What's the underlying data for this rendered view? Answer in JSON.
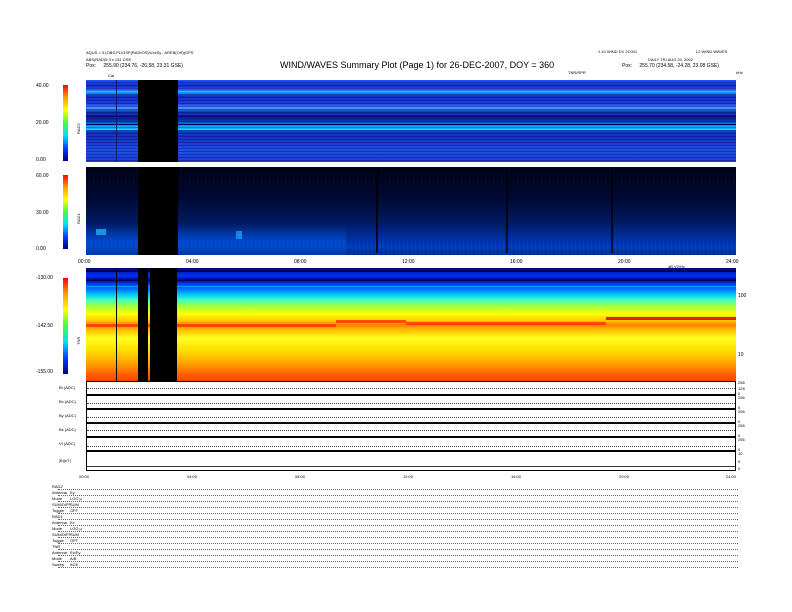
{
  "header": {
    "title": "WIND/WAVES Summary Plot (Page 1) for 26-DEC-2007, DOY = 360",
    "left_line1": "AQUS = 3 (OBS:PLIOSP(RADIOS)/UxxSy : AREB(OS))GPS",
    "left_line2": "ABS(RAD)5:3 x 131 GSE",
    "left_pos_label": "Pos:",
    "left_pos_value": "255.90 (234.76, -26.58, 23.31 GSE)",
    "right_line1": "1.10 WIND DV 2C001",
    "right_line2": "L2 WIND WAVES",
    "right_line3": "DAILY TRI AUG 20, 2002",
    "right_pos_label": "Pos:",
    "right_pos_value": "255.70 (234.58, -24.28, 23.08 GSE)",
    "cal_marker": "Cal",
    "top_right_label": "TNR/RPR",
    "top_right_unit": "kHz"
  },
  "panels": {
    "rad2": {
      "label": "RAD2",
      "ticks": [
        "40.00",
        "20.00",
        "0.00"
      ]
    },
    "rad1": {
      "label": "RAD1",
      "ticks": [
        "60.00",
        "30.00",
        "0.00"
      ]
    },
    "tnr": {
      "label": "TNR",
      "ticks": [
        "-130.00",
        "-142.50",
        "-155.00"
      ],
      "right_ticks": [
        "100",
        "10"
      ],
      "unit_label": "dB V2/Hz"
    }
  },
  "chart_data": [
    {
      "type": "heatmap",
      "title": "RAD2",
      "ylim": [
        0,
        40
      ],
      "x": [
        "00:00",
        "04:00",
        "08:00",
        "12:00",
        "16:00",
        "20:00",
        "24:00"
      ],
      "data_gaps_hours": [
        [
          2.05,
          2.8
        ],
        [
          2.8,
          3.35
        ]
      ]
    },
    {
      "type": "heatmap",
      "title": "RAD1",
      "ylim": [
        0,
        60
      ],
      "x": [
        "00:00",
        "04:00",
        "08:00",
        "12:00",
        "16:00",
        "20:00",
        "24:00"
      ],
      "data_gaps_hours": [
        [
          2.05,
          3.35
        ]
      ]
    },
    {
      "type": "heatmap",
      "title": "TNR",
      "ylim": [
        -155,
        -130
      ],
      "x": [
        "00:00",
        "04:00",
        "08:00",
        "12:00",
        "16:00",
        "20:00",
        "24:00"
      ],
      "data_gaps_hours": [
        [
          2.05,
          2.55
        ],
        [
          2.65,
          2.95
        ],
        [
          2.95,
          3.35
        ]
      ]
    }
  ],
  "time_axis_rad1": [
    "00:00",
    "04:00",
    "08:00",
    "12:00",
    "16:00",
    "20:00",
    "24:00"
  ],
  "time_axis_tnr": [
    "00:00",
    "04:00",
    "08:00",
    "12:00",
    "16:00",
    "20:00",
    "24:00"
  ],
  "time_axis_bottom": [
    "00:00",
    "04:00",
    "08:00",
    "12:00",
    "16:00",
    "20:00",
    "24:00"
  ],
  "line_panels": [
    {
      "label": "Bt (ADC)",
      "right_ticks": [
        "256",
        "128",
        "0"
      ]
    },
    {
      "label": "Bx (ADC)",
      "right_ticks": [
        "256",
        "0"
      ]
    },
    {
      "label": "By (ADC)",
      "right_ticks": [
        "256",
        "0"
      ]
    },
    {
      "label": "Bz (ADC)",
      "right_ticks": [
        "256",
        "0"
      ]
    },
    {
      "label": "Vt (ADC)",
      "right_ticks": [
        "256",
        "0"
      ]
    },
    {
      "label": "|B|(nT)",
      "right_ticks": [
        "10",
        "5",
        "0"
      ]
    }
  ],
  "info_block": [
    {
      "label": "RAD2",
      "value": ""
    },
    {
      "label": "Antenna",
      "value": "Ey"
    },
    {
      "label": "Mode",
      "value": "LOG µ"
    },
    {
      "label": "SUM/DIFF",
      "value": "SUM"
    },
    {
      "label": "Toggle",
      "value": "OFF"
    },
    {
      "label": "RAD1",
      "value": ""
    },
    {
      "label": "Antenna",
      "value": "Ex"
    },
    {
      "label": "Mode",
      "value": "LOG µ"
    },
    {
      "label": "SUM/DIFF",
      "value": "SUM"
    },
    {
      "label": "Toggle",
      "value": "OFF"
    },
    {
      "label": "TNR",
      "value": ""
    },
    {
      "label": "Antenna",
      "value": "Ex/Ey"
    },
    {
      "label": "Mode",
      "value": "A/B"
    },
    {
      "label": "Sweep",
      "value": "ACE"
    }
  ],
  "colors": {
    "deep_blue": "#000080",
    "blue": "#0040ff",
    "cyan": "#00e0ff",
    "green": "#40ff40",
    "yellow": "#ffff00",
    "orange": "#ff8000",
    "red": "#e00000"
  }
}
